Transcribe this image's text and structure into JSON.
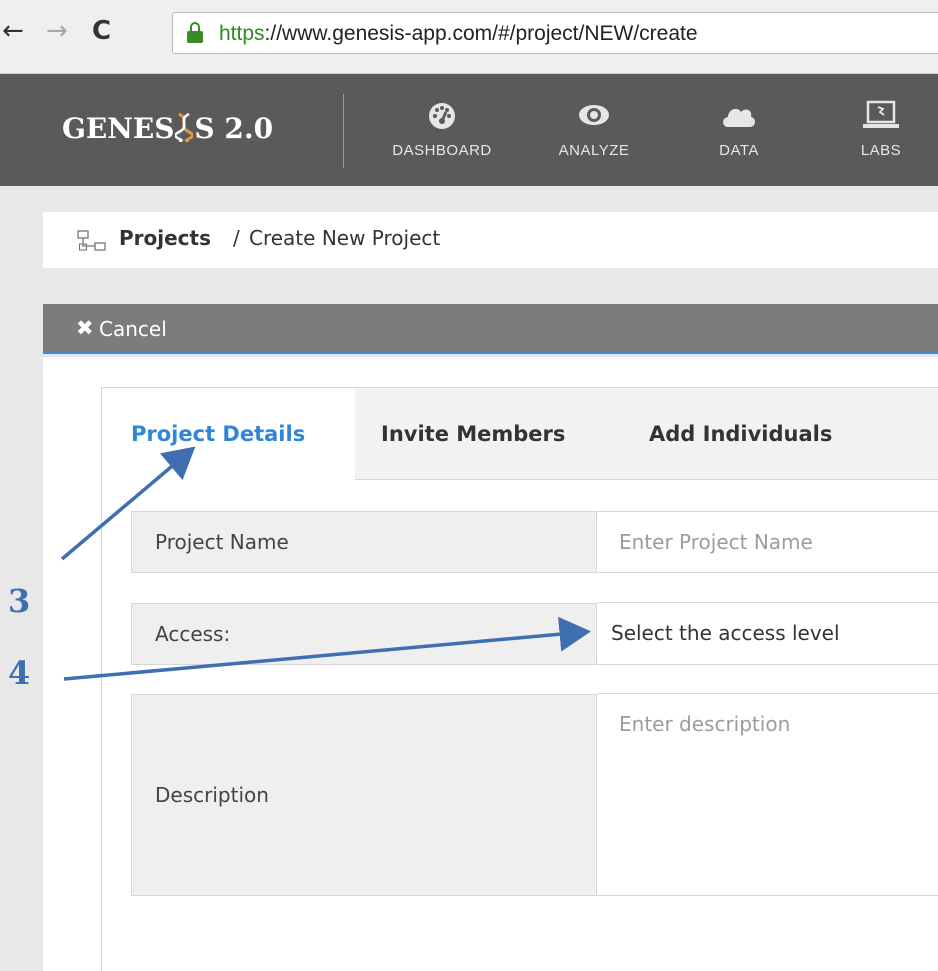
{
  "browser": {
    "url_scheme": "https",
    "url_rest": "://www.genesis-app.com/#/project/NEW/create",
    "back_glyph": "←",
    "forward_glyph": "→",
    "reload_glyph": "C"
  },
  "header": {
    "logo_part1": "GENES",
    "logo_part2": "S 2.0",
    "nav": [
      {
        "label": "DASHBOARD",
        "icon": "dashboard-gauge-icon"
      },
      {
        "label": "ANALYZE",
        "icon": "eye-icon"
      },
      {
        "label": "DATA",
        "icon": "cloud-icon"
      },
      {
        "label": "LABS",
        "icon": "laptop-icon"
      }
    ],
    "colors": {
      "bar": "#5a5a5a",
      "text": "#e6e6e6"
    }
  },
  "breadcrumb": {
    "icon": "projects-sitemap-icon",
    "root": "Projects",
    "separator": "/",
    "current": "Create New Project"
  },
  "cancel": {
    "icon": "close-icon",
    "label": "Cancel"
  },
  "tabs": [
    {
      "label": "Project Details",
      "active": true
    },
    {
      "label": "Invite Members",
      "active": false
    },
    {
      "label": "Add Individuals",
      "active": false
    }
  ],
  "form": {
    "project_name": {
      "label": "Project Name",
      "placeholder": "Enter Project Name"
    },
    "access": {
      "label": "Access:",
      "value": "Select the access level"
    },
    "description": {
      "label": "Description",
      "placeholder": "Enter description"
    }
  },
  "annotations": [
    {
      "number": "3",
      "target": "Project Details tab"
    },
    {
      "number": "4",
      "target": "Access select"
    }
  ],
  "colors": {
    "accent": "#2f86d9",
    "annotation": "#3f6fb0",
    "cancel_bar": "#7c7c7c"
  }
}
